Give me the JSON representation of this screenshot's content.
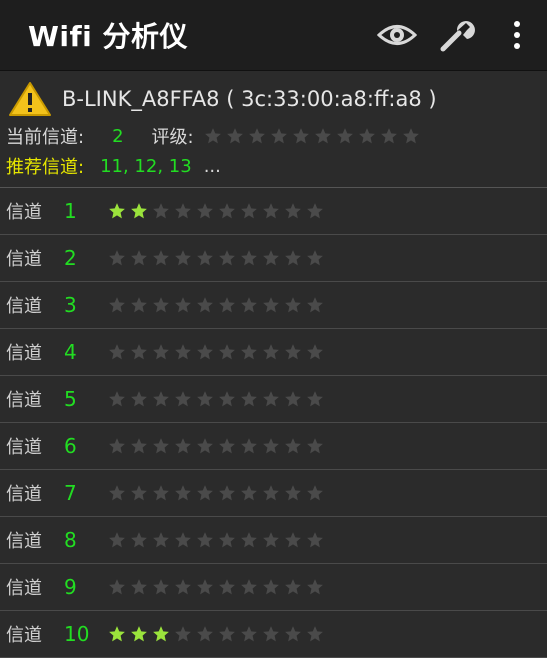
{
  "app": {
    "title": "Wifi 分析仪"
  },
  "toolbar": [
    {
      "icon": "eye-icon"
    },
    {
      "icon": "wrench-icon"
    },
    {
      "icon": "overflow-menu-icon"
    }
  ],
  "network": {
    "warning_icon": "warning-icon",
    "ssid_line": "B-LINK_A8FFA8 ( 3c:33:00:a8:ff:a8 )",
    "current_channel_label": "当前信道:",
    "current_channel": "2",
    "rating_label": "评级:",
    "rating": 0,
    "max_rating": 10,
    "recommended_label": "推荐信道:",
    "recommended_channels": "11, 12, 13",
    "more": "..."
  },
  "channel_label": "信道",
  "channels": [
    {
      "num": "1",
      "rating": 2
    },
    {
      "num": "2",
      "rating": 0
    },
    {
      "num": "3",
      "rating": 0
    },
    {
      "num": "4",
      "rating": 0
    },
    {
      "num": "5",
      "rating": 0
    },
    {
      "num": "6",
      "rating": 0
    },
    {
      "num": "7",
      "rating": 0
    },
    {
      "num": "8",
      "rating": 0
    },
    {
      "num": "9",
      "rating": 0
    },
    {
      "num": "10",
      "rating": 3
    }
  ],
  "colors": {
    "star_filled": "#9be33c",
    "star_empty": "#4a4a4a",
    "accent_green": "#22dd22",
    "accent_yellow": "#e6e600"
  }
}
